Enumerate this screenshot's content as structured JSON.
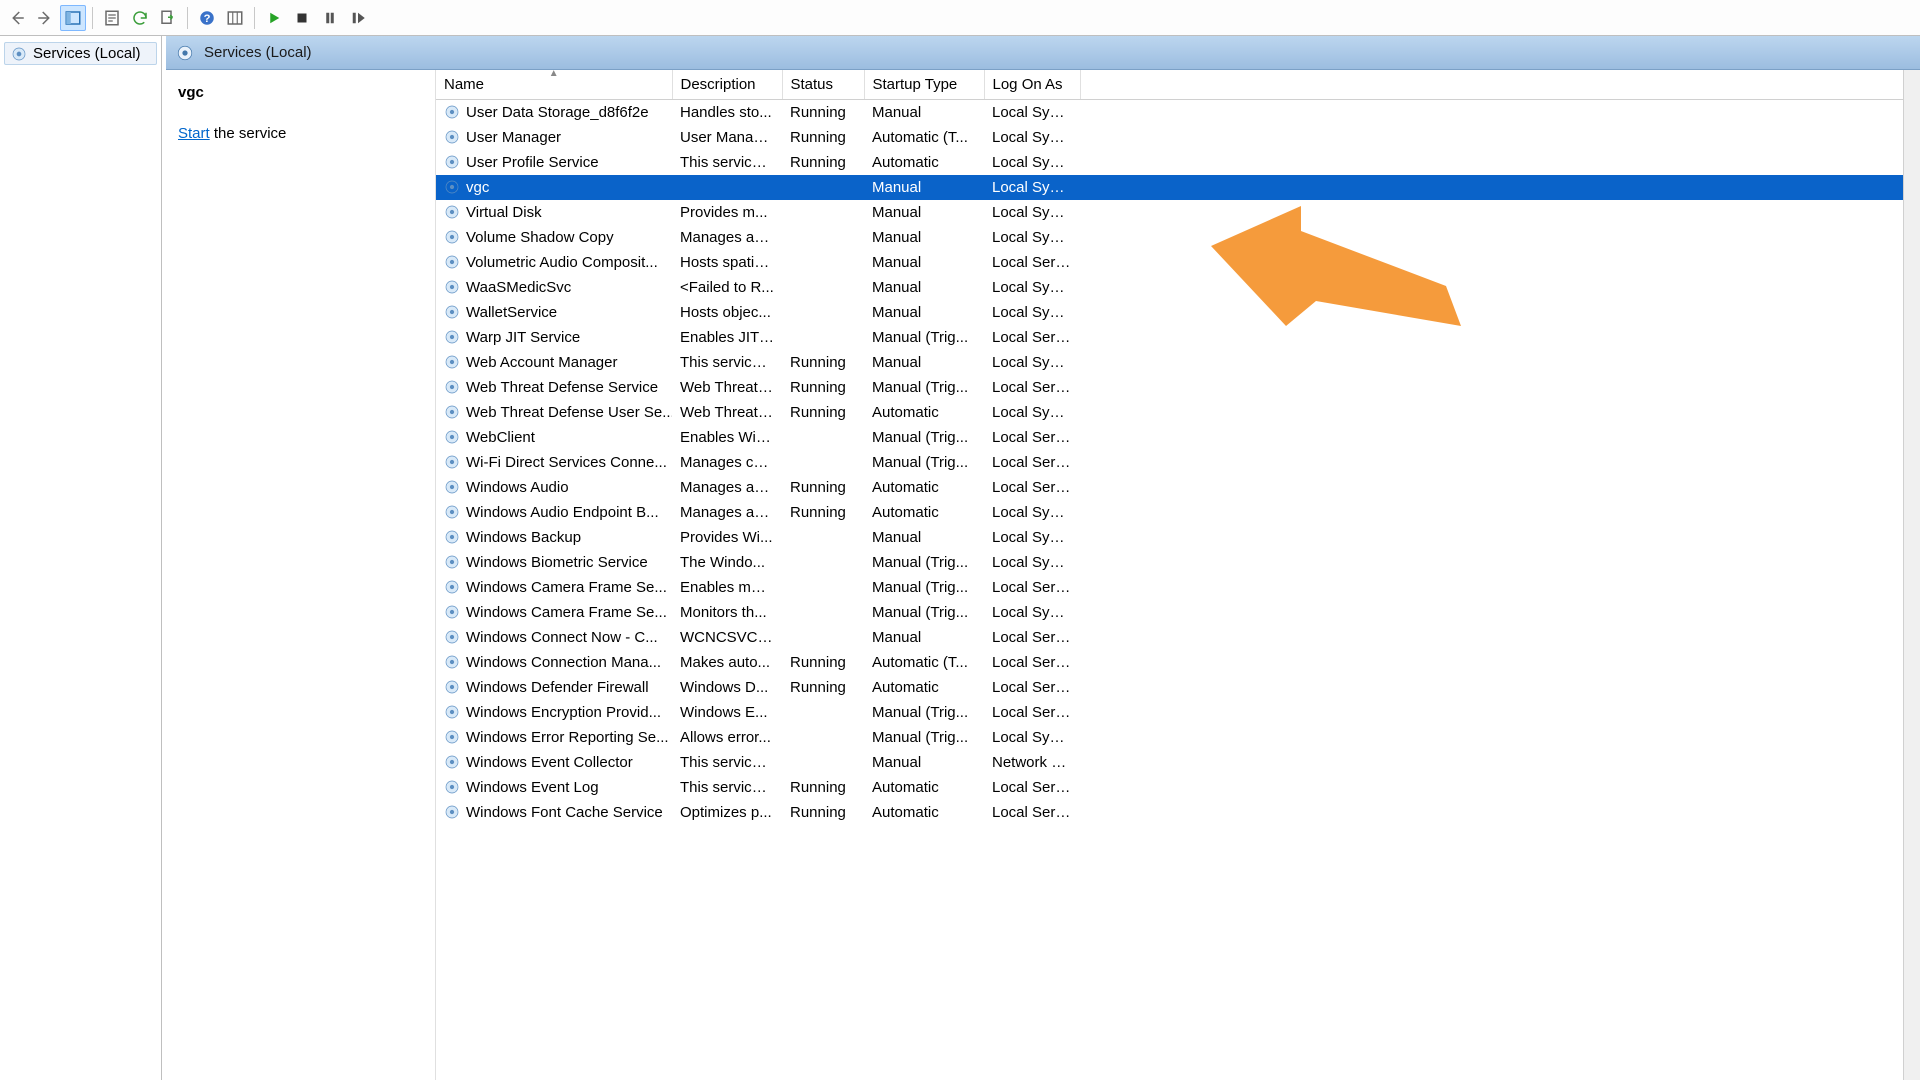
{
  "toolbar": {
    "back": "Back",
    "forward": "Forward",
    "up": "Show/Hide tree",
    "properties": "Properties",
    "refresh": "Refresh",
    "export": "Export list",
    "help": "Help",
    "columns": "Choose columns",
    "start": "Start",
    "stop": "Stop",
    "pause": "Pause",
    "restart": "Restart"
  },
  "tree": {
    "root": "Services (Local)"
  },
  "header": {
    "title": "Services (Local)"
  },
  "detail": {
    "selected_name": "vgc",
    "start_link": "Start",
    "start_suffix": " the service"
  },
  "columns": {
    "name": "Name",
    "description": "Description",
    "status": "Status",
    "startup": "Startup Type",
    "logon": "Log On As"
  },
  "selected_index": 3,
  "services": [
    {
      "name": "User Data Storage_d8f6f2e",
      "description": "Handles sto...",
      "status": "Running",
      "startup": "Manual",
      "logon": "Local Syste..."
    },
    {
      "name": "User Manager",
      "description": "User Manag...",
      "status": "Running",
      "startup": "Automatic (T...",
      "logon": "Local Syste..."
    },
    {
      "name": "User Profile Service",
      "description": "This service ...",
      "status": "Running",
      "startup": "Automatic",
      "logon": "Local Syste..."
    },
    {
      "name": "vgc",
      "description": "",
      "status": "",
      "startup": "Manual",
      "logon": "Local Syste..."
    },
    {
      "name": "Virtual Disk",
      "description": "Provides m...",
      "status": "",
      "startup": "Manual",
      "logon": "Local Syste..."
    },
    {
      "name": "Volume Shadow Copy",
      "description": "Manages an...",
      "status": "",
      "startup": "Manual",
      "logon": "Local Syste..."
    },
    {
      "name": "Volumetric Audio Composit...",
      "description": "Hosts spatia...",
      "status": "",
      "startup": "Manual",
      "logon": "Local Service"
    },
    {
      "name": "WaaSMedicSvc",
      "description": "<Failed to R...",
      "status": "",
      "startup": "Manual",
      "logon": "Local Syste..."
    },
    {
      "name": "WalletService",
      "description": "Hosts objec...",
      "status": "",
      "startup": "Manual",
      "logon": "Local Syste..."
    },
    {
      "name": "Warp JIT Service",
      "description": "Enables JIT ...",
      "status": "",
      "startup": "Manual (Trig...",
      "logon": "Local Service"
    },
    {
      "name": "Web Account Manager",
      "description": "This service ...",
      "status": "Running",
      "startup": "Manual",
      "logon": "Local Syste..."
    },
    {
      "name": "Web Threat Defense Service",
      "description": "Web Threat ...",
      "status": "Running",
      "startup": "Manual (Trig...",
      "logon": "Local Service"
    },
    {
      "name": "Web Threat Defense User Se...",
      "description": "Web Threat ...",
      "status": "Running",
      "startup": "Automatic",
      "logon": "Local Syste..."
    },
    {
      "name": "WebClient",
      "description": "Enables Win...",
      "status": "",
      "startup": "Manual (Trig...",
      "logon": "Local Service"
    },
    {
      "name": "Wi-Fi Direct Services Conne...",
      "description": "Manages co...",
      "status": "",
      "startup": "Manual (Trig...",
      "logon": "Local Service"
    },
    {
      "name": "Windows Audio",
      "description": "Manages au...",
      "status": "Running",
      "startup": "Automatic",
      "logon": "Local Service"
    },
    {
      "name": "Windows Audio Endpoint B...",
      "description": "Manages au...",
      "status": "Running",
      "startup": "Automatic",
      "logon": "Local Syste..."
    },
    {
      "name": "Windows Backup",
      "description": "Provides Wi...",
      "status": "",
      "startup": "Manual",
      "logon": "Local Syste..."
    },
    {
      "name": "Windows Biometric Service",
      "description": "The Windo...",
      "status": "",
      "startup": "Manual (Trig...",
      "logon": "Local Syste..."
    },
    {
      "name": "Windows Camera Frame Se...",
      "description": "Enables mul...",
      "status": "",
      "startup": "Manual (Trig...",
      "logon": "Local Service"
    },
    {
      "name": "Windows Camera Frame Se...",
      "description": "Monitors th...",
      "status": "",
      "startup": "Manual (Trig...",
      "logon": "Local Syste..."
    },
    {
      "name": "Windows Connect Now - C...",
      "description": "WCNCSVC ...",
      "status": "",
      "startup": "Manual",
      "logon": "Local Service"
    },
    {
      "name": "Windows Connection Mana...",
      "description": "Makes auto...",
      "status": "Running",
      "startup": "Automatic (T...",
      "logon": "Local Service"
    },
    {
      "name": "Windows Defender Firewall",
      "description": "Windows D...",
      "status": "Running",
      "startup": "Automatic",
      "logon": "Local Service"
    },
    {
      "name": "Windows Encryption Provid...",
      "description": "Windows E...",
      "status": "",
      "startup": "Manual (Trig...",
      "logon": "Local Service"
    },
    {
      "name": "Windows Error Reporting Se...",
      "description": "Allows error...",
      "status": "",
      "startup": "Manual (Trig...",
      "logon": "Local Syste..."
    },
    {
      "name": "Windows Event Collector",
      "description": "This service ...",
      "status": "",
      "startup": "Manual",
      "logon": "Network S..."
    },
    {
      "name": "Windows Event Log",
      "description": "This service ...",
      "status": "Running",
      "startup": "Automatic",
      "logon": "Local Service"
    },
    {
      "name": "Windows Font Cache Service",
      "description": "Optimizes p...",
      "status": "Running",
      "startup": "Automatic",
      "logon": "Local Service"
    }
  ]
}
